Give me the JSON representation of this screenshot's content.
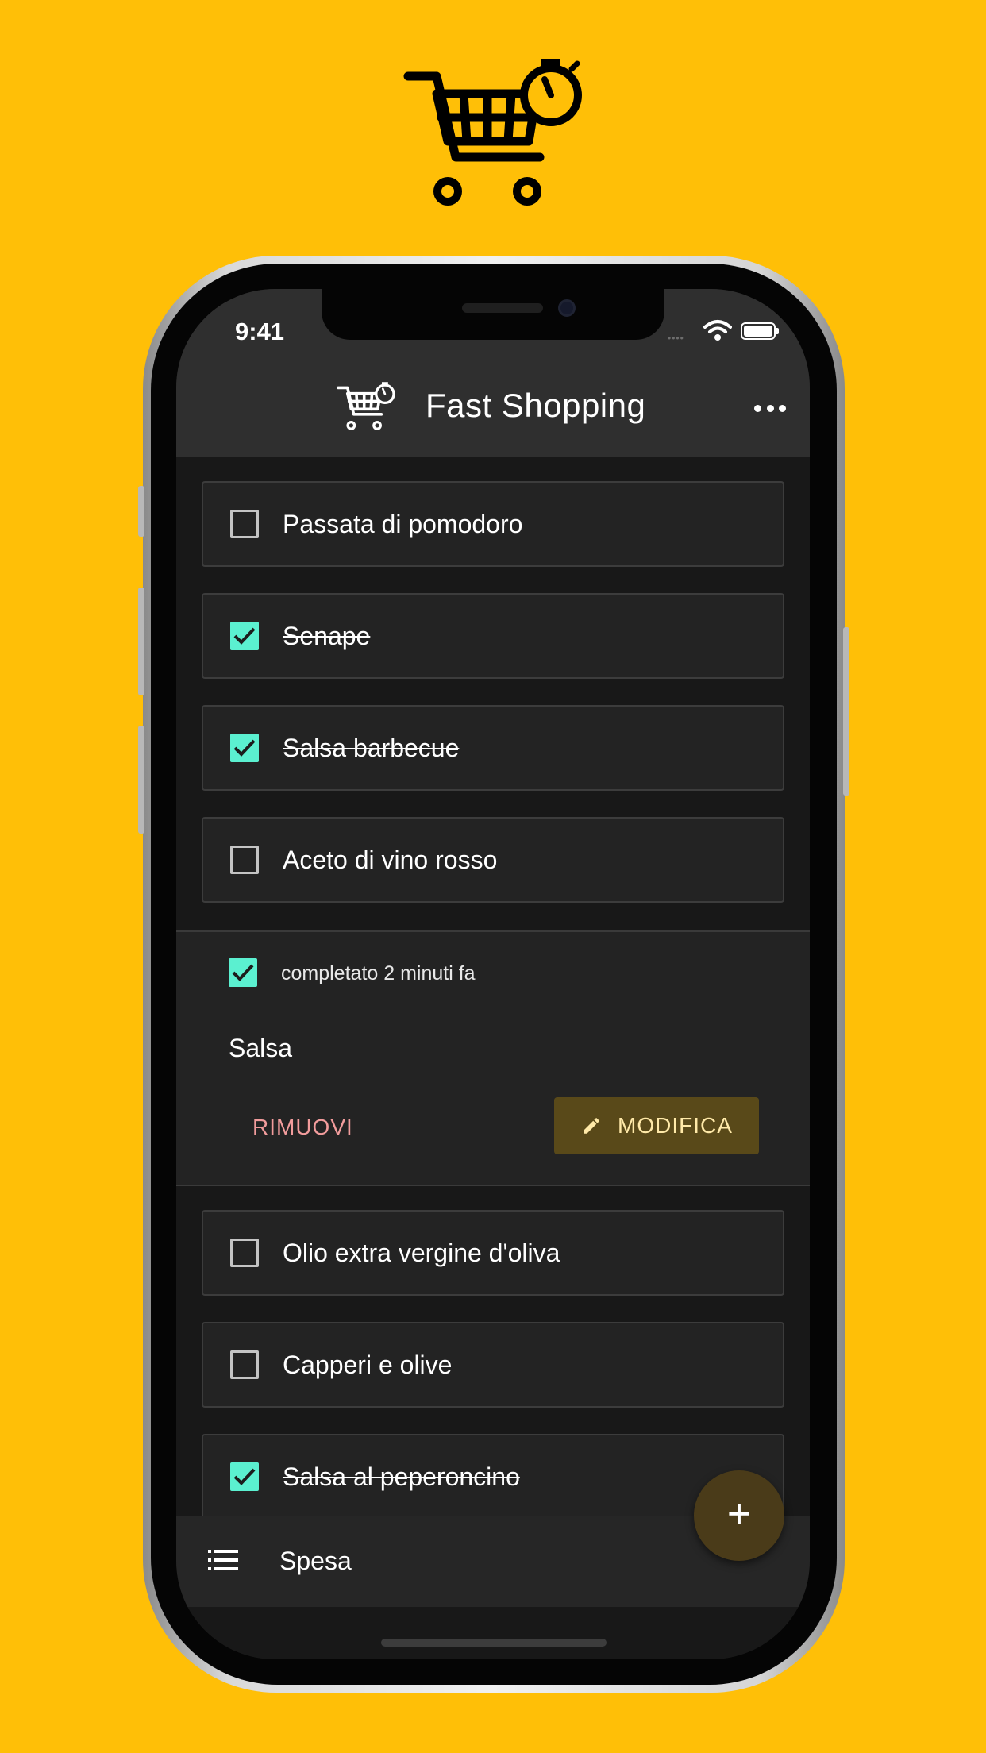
{
  "status_bar": {
    "time": "9:41"
  },
  "app_bar": {
    "title": "Fast Shopping"
  },
  "items_top": [
    {
      "label": "Passata di pomodoro",
      "checked": false
    },
    {
      "label": "Senape",
      "checked": true
    },
    {
      "label": "Salsa barbecue",
      "checked": true
    },
    {
      "label": "Aceto di vino rosso",
      "checked": false
    }
  ],
  "expanded_item": {
    "meta": "completato 2 minuti fa",
    "name": "Salsa",
    "remove_label": "RIMUOVI",
    "edit_label": "MODIFICA"
  },
  "items_bottom": [
    {
      "label": "Olio extra vergine d'oliva",
      "checked": false
    },
    {
      "label": "Capperi e olive",
      "checked": false
    },
    {
      "label": "Salsa al peperoncino",
      "checked": true
    }
  ],
  "fab": {
    "label": "+"
  },
  "bottom_bar": {
    "label": "Spesa"
  },
  "colors": {
    "background": "#FFBF07",
    "check_accent": "#5BF0D0",
    "remove_text": "#F29C9C",
    "edit_button_bg": "#594919",
    "edit_button_text": "#FFE9A8",
    "fab_bg": "#4a3b19"
  },
  "icons": [
    "cart-timer-icon",
    "wifi-icon",
    "battery-icon",
    "more-icon",
    "checkmark-icon",
    "pencil-icon",
    "plus-icon",
    "list-icon"
  ]
}
